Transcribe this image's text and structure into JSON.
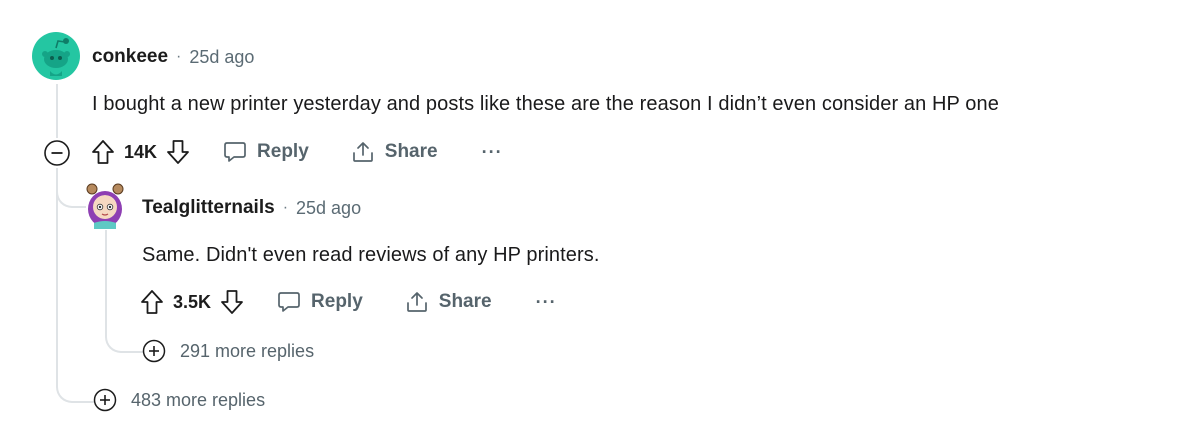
{
  "comment": {
    "author": "conkeee",
    "separator": "·",
    "time": "25d ago",
    "text": "I bought a new printer yesterday and posts like these are the reason I didn’t even consider an HP one",
    "score": "14K",
    "reply_label": "Reply",
    "share_label": "Share",
    "more_label": "···",
    "more_replies": "483 more replies",
    "avatar_color": "#24c6a2"
  },
  "reply": {
    "author": "Tealglitternails",
    "separator": "·",
    "time": "25d ago",
    "text": "Same. Didn't even read reviews of any HP printers.",
    "score": "3.5K",
    "reply_label": "Reply",
    "share_label": "Share",
    "more_label": "···",
    "more_replies": "291 more replies",
    "avatar_color": "#8e3fb3"
  },
  "colors": {
    "text_muted": "#56646c",
    "thread_line": "#dfe3e6"
  }
}
